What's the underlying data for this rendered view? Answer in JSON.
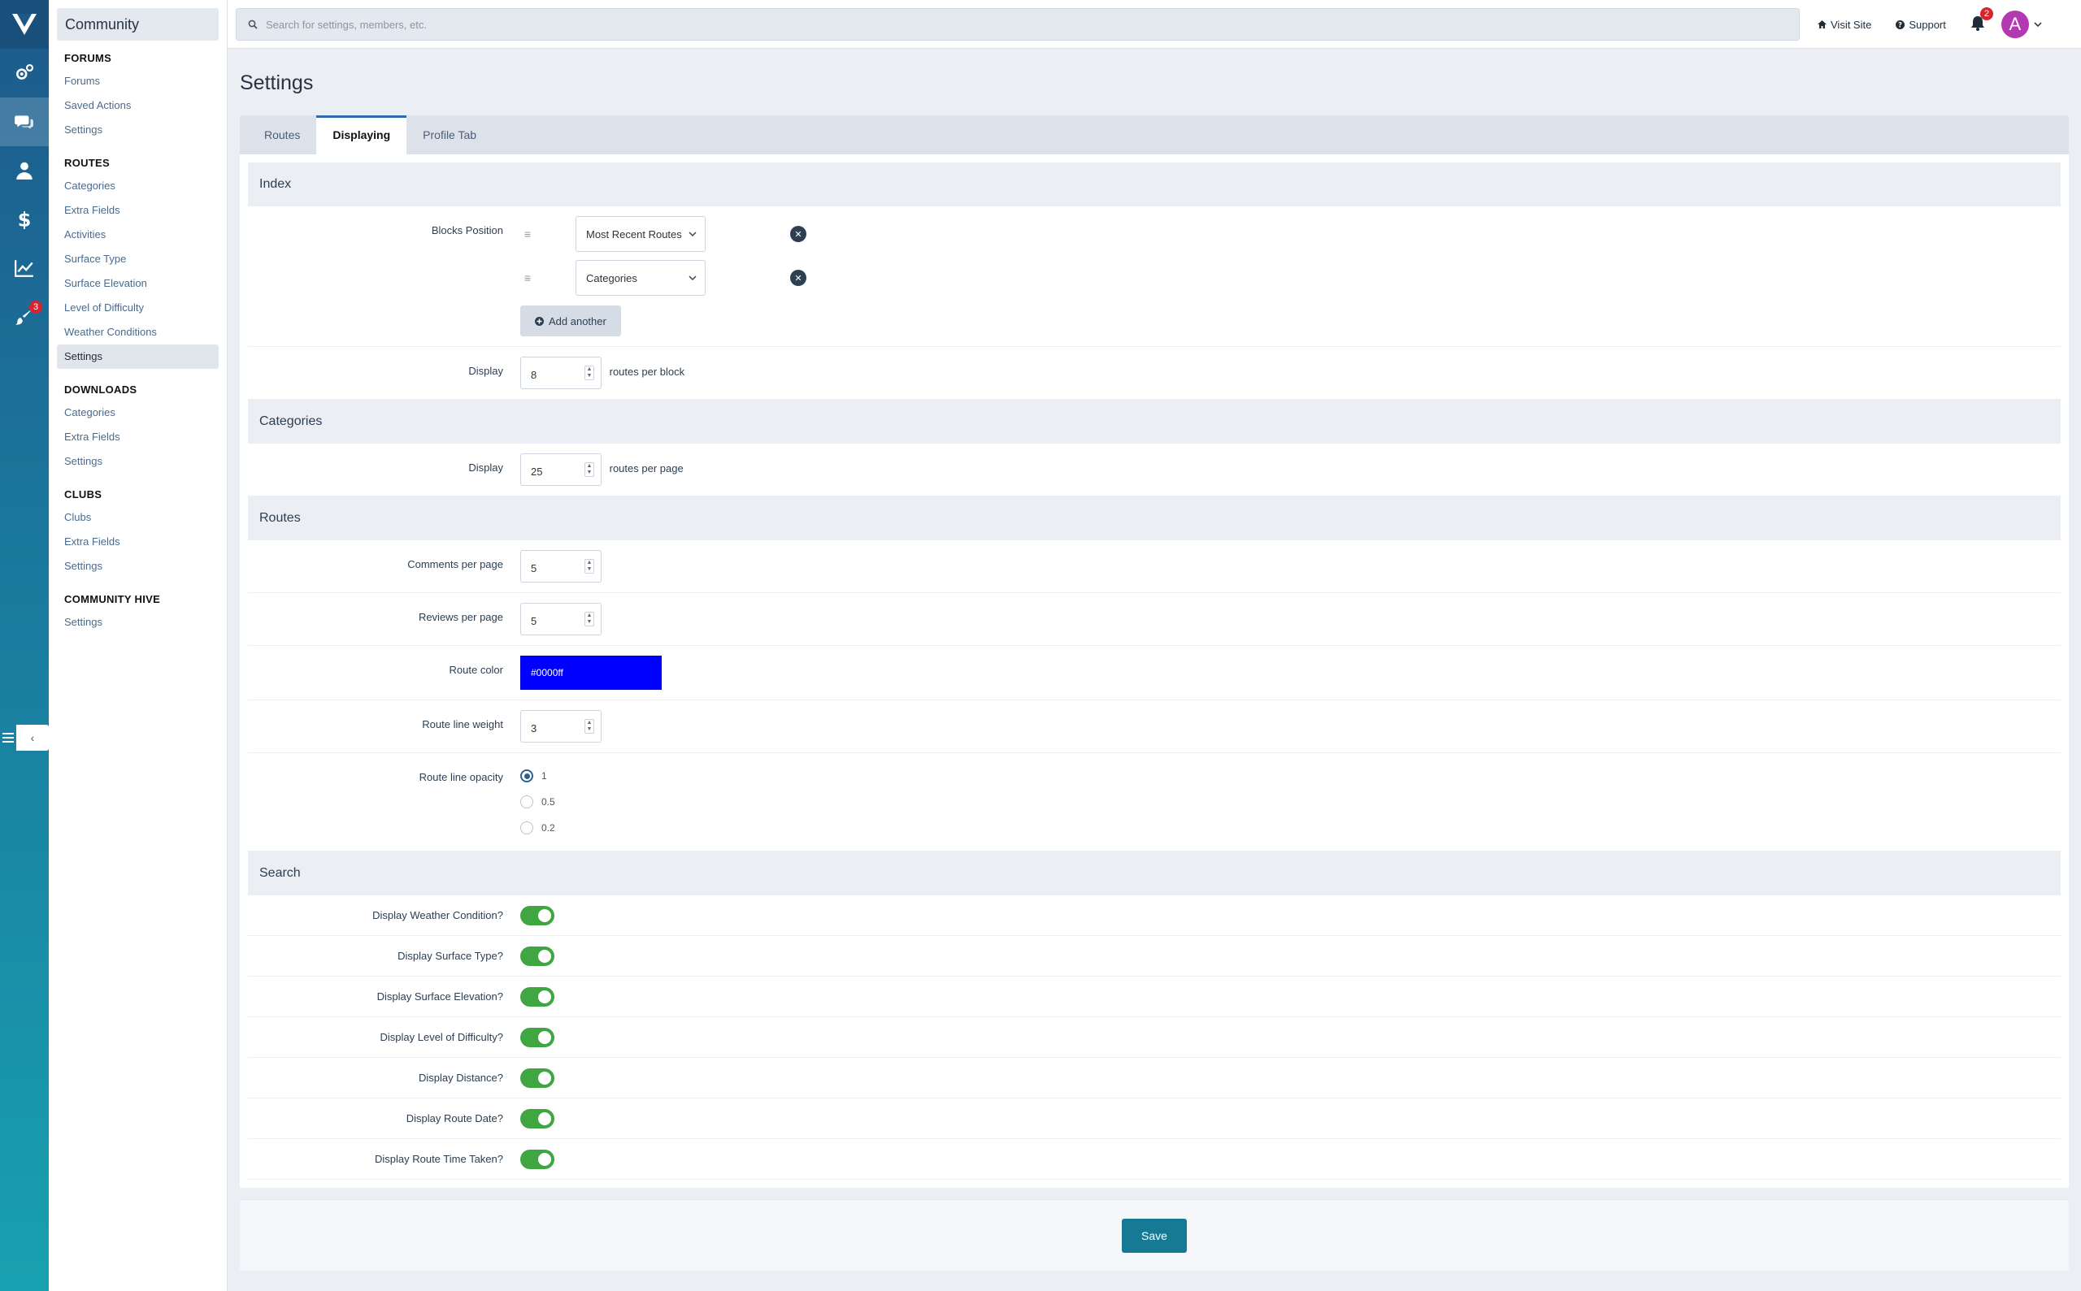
{
  "app": {
    "title": "Community"
  },
  "topbar": {
    "search_placeholder": "Search for settings, members, etc.",
    "visit_site": "Visit Site",
    "support": "Support",
    "notifications_count": "2",
    "avatar_initial": "A"
  },
  "rail": {
    "customization_badge": "3"
  },
  "sidebar": {
    "sections": [
      {
        "title": "FORUMS",
        "items": [
          "Forums",
          "Saved Actions",
          "Settings"
        ]
      },
      {
        "title": "ROUTES",
        "items": [
          "Categories",
          "Extra Fields",
          "Activities",
          "Surface Type",
          "Surface Elevation",
          "Level of Difficulty",
          "Weather Conditions",
          "Settings"
        ]
      },
      {
        "title": "DOWNLOADS",
        "items": [
          "Categories",
          "Extra Fields",
          "Settings"
        ]
      },
      {
        "title": "CLUBS",
        "items": [
          "Clubs",
          "Extra Fields",
          "Settings"
        ]
      },
      {
        "title": "COMMUNITY HIVE",
        "items": [
          "Settings"
        ]
      }
    ]
  },
  "page": {
    "title": "Settings",
    "tabs": [
      "Routes",
      "Displaying",
      "Profile Tab"
    ],
    "active_tab": "Displaying"
  },
  "index": {
    "header": "Index",
    "blocks_label": "Blocks Position",
    "blocks": [
      "Most Recent Routes",
      "Categories"
    ],
    "add_another": "Add another",
    "display_label": "Display",
    "display_value": "8",
    "display_suffix": "routes per block"
  },
  "categories": {
    "header": "Categories",
    "display_label": "Display",
    "display_value": "25",
    "display_suffix": "routes per page"
  },
  "routes": {
    "header": "Routes",
    "comments_label": "Comments per page",
    "comments_value": "5",
    "reviews_label": "Reviews per page",
    "reviews_value": "5",
    "color_label": "Route color",
    "color_value": "#0000ff",
    "weight_label": "Route line weight",
    "weight_value": "3",
    "opacity_label": "Route line opacity",
    "opacity_options": [
      "1",
      "0.5",
      "0.2"
    ],
    "opacity_selected": "1"
  },
  "search": {
    "header": "Search",
    "toggles": [
      {
        "label": "Display Weather Condition?",
        "on": true
      },
      {
        "label": "Display Surface Type?",
        "on": true
      },
      {
        "label": "Display Surface Elevation?",
        "on": true
      },
      {
        "label": "Display Level of Difficulty?",
        "on": true
      },
      {
        "label": "Display Distance?",
        "on": true
      },
      {
        "label": "Display Route Date?",
        "on": true
      },
      {
        "label": "Display Route Time Taken?",
        "on": true
      }
    ]
  },
  "footer": {
    "save": "Save"
  },
  "colors": {
    "accent": "#167a94",
    "toggle_on": "#3fa642",
    "badge": "#d9232d",
    "avatar": "#b338b1"
  }
}
